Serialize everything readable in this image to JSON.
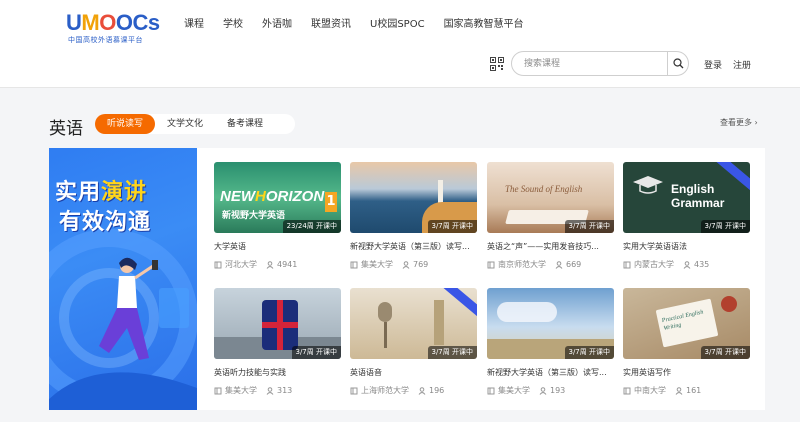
{
  "header": {
    "logo_text": "UMOOCs",
    "logo_sub": "中国高校外语慕课平台",
    "nav": [
      "课程",
      "学校",
      "外语咖",
      "联盟资讯",
      "U校园SPOC",
      "国家高教智慧平台"
    ],
    "search_placeholder": "搜索课程",
    "login": "登录",
    "register": "注册"
  },
  "section": {
    "title": "英语",
    "tabs": [
      "听说读写",
      "文学文化",
      "备考课程"
    ],
    "active_tab": 0,
    "see_more": "查看更多 ›"
  },
  "banner": {
    "line1_a": "实用",
    "line1_b": "演讲",
    "line2_a": "有效",
    "line2_b": "沟通"
  },
  "courses": [
    {
      "title": "大学英语",
      "school": "河北大学",
      "users": "4941",
      "status": "23/24周 开课中",
      "thumb_text": "新视野大学英语"
    },
    {
      "title": "新视野大学英语（第三版）读写...",
      "school": "集美大学",
      "users": "769",
      "status": "3/7周 开课中"
    },
    {
      "title": "英语之“声”——实用发音技巧...",
      "school": "南京师范大学",
      "users": "669",
      "status": "3/7周 开课中",
      "thumb_text": "The Sound of English"
    },
    {
      "title": "实用大学英语语法",
      "school": "内蒙古大学",
      "users": "435",
      "status": "3/7周 开课中",
      "thumb_text": "English Grammar"
    },
    {
      "title": "英语听力技能与实践",
      "school": "集美大学",
      "users": "313",
      "status": "3/7周 开课中"
    },
    {
      "title": "英语语音",
      "school": "上海师范大学",
      "users": "196",
      "status": "3/7周 开课中"
    },
    {
      "title": "新视野大学英语（第三版）读写...",
      "school": "集美大学",
      "users": "193",
      "status": "3/7周 开课中"
    },
    {
      "title": "实用英语写作",
      "school": "中南大学",
      "users": "161",
      "status": "3/7周 开课中",
      "thumb_text": "Practical English Writing"
    }
  ],
  "colors": {
    "accent": "#f56a00",
    "brand": "#2a5ec7"
  }
}
